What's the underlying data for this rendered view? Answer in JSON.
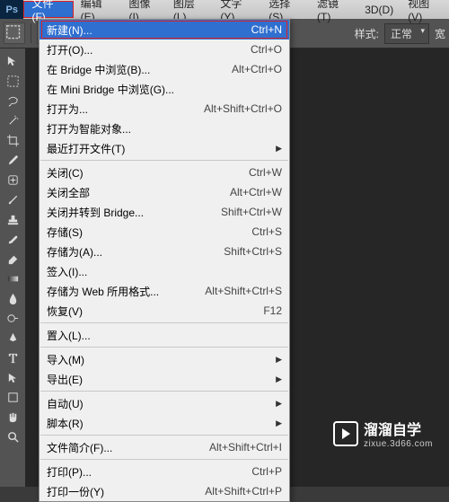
{
  "app": {
    "logo": "Ps"
  },
  "menubar": [
    {
      "label": "文件(F)",
      "active": true
    },
    {
      "label": "编辑(E)"
    },
    {
      "label": "图像(I)"
    },
    {
      "label": "图层(L)"
    },
    {
      "label": "文字(Y)"
    },
    {
      "label": "选择(S)"
    },
    {
      "label": "滤镜(T)"
    },
    {
      "label": "3D(D)"
    },
    {
      "label": "视图(V)"
    }
  ],
  "toolbar": {
    "style_label": "样式:",
    "style_value": "正常",
    "width_label": "宽"
  },
  "dropdown": [
    {
      "type": "item",
      "label": "新建(N)...",
      "shortcut": "Ctrl+N",
      "hl": true,
      "redbox": true
    },
    {
      "type": "item",
      "label": "打开(O)...",
      "shortcut": "Ctrl+O"
    },
    {
      "type": "item",
      "label": "在 Bridge 中浏览(B)...",
      "shortcut": "Alt+Ctrl+O"
    },
    {
      "type": "item",
      "label": "在 Mini Bridge 中浏览(G)..."
    },
    {
      "type": "item",
      "label": "打开为...",
      "shortcut": "Alt+Shift+Ctrl+O"
    },
    {
      "type": "item",
      "label": "打开为智能对象..."
    },
    {
      "type": "item",
      "label": "最近打开文件(T)",
      "submenu": true
    },
    {
      "type": "sep"
    },
    {
      "type": "item",
      "label": "关闭(C)",
      "shortcut": "Ctrl+W"
    },
    {
      "type": "item",
      "label": "关闭全部",
      "shortcut": "Alt+Ctrl+W"
    },
    {
      "type": "item",
      "label": "关闭并转到 Bridge...",
      "shortcut": "Shift+Ctrl+W"
    },
    {
      "type": "item",
      "label": "存储(S)",
      "shortcut": "Ctrl+S"
    },
    {
      "type": "item",
      "label": "存储为(A)...",
      "shortcut": "Shift+Ctrl+S"
    },
    {
      "type": "item",
      "label": "签入(I)..."
    },
    {
      "type": "item",
      "label": "存储为 Web 所用格式...",
      "shortcut": "Alt+Shift+Ctrl+S"
    },
    {
      "type": "item",
      "label": "恢复(V)",
      "shortcut": "F12"
    },
    {
      "type": "sep"
    },
    {
      "type": "item",
      "label": "置入(L)..."
    },
    {
      "type": "sep"
    },
    {
      "type": "item",
      "label": "导入(M)",
      "submenu": true
    },
    {
      "type": "item",
      "label": "导出(E)",
      "submenu": true
    },
    {
      "type": "sep"
    },
    {
      "type": "item",
      "label": "自动(U)",
      "submenu": true
    },
    {
      "type": "item",
      "label": "脚本(R)",
      "submenu": true
    },
    {
      "type": "sep"
    },
    {
      "type": "item",
      "label": "文件简介(F)...",
      "shortcut": "Alt+Shift+Ctrl+I"
    },
    {
      "type": "sep"
    },
    {
      "type": "item",
      "label": "打印(P)...",
      "shortcut": "Ctrl+P"
    },
    {
      "type": "item",
      "label": "打印一份(Y)",
      "shortcut": "Alt+Shift+Ctrl+P"
    }
  ],
  "watermark": {
    "title": "溜溜自学",
    "sub": "zixue.3d66.com"
  }
}
